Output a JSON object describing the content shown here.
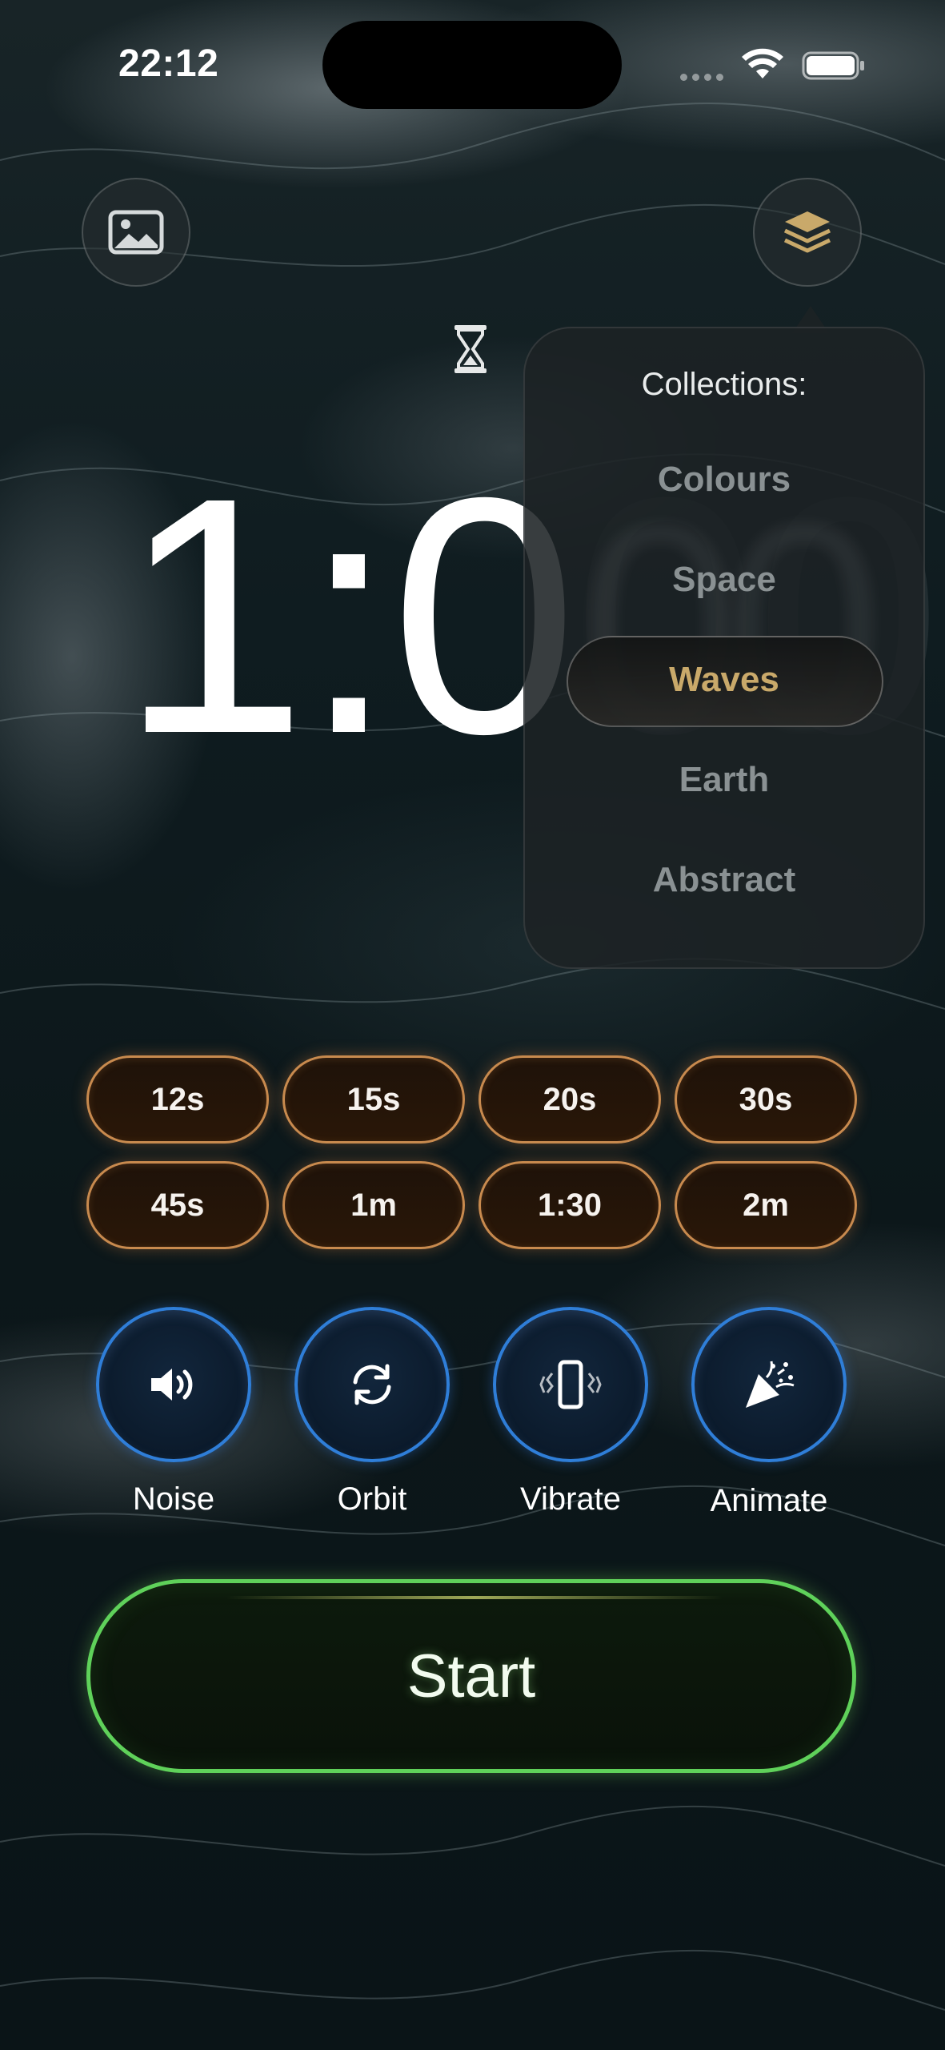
{
  "status_bar": {
    "time": "22:12",
    "wifi_icon": "wifi-icon",
    "battery_icon": "battery-icon"
  },
  "top_bar": {
    "left_icon": "image-gallery-icon",
    "right_icon": "layers-icon",
    "center_icon": "hourglass-icon"
  },
  "timer": {
    "visible": "1:0",
    "hidden": "00"
  },
  "collections": {
    "title": "Collections:",
    "items": [
      {
        "label": "Colours",
        "selected": false
      },
      {
        "label": "Space",
        "selected": false
      },
      {
        "label": "Waves",
        "selected": true
      },
      {
        "label": "Earth",
        "selected": false
      },
      {
        "label": "Abstract",
        "selected": false
      }
    ]
  },
  "durations": [
    "12s",
    "15s",
    "20s",
    "30s",
    "45s",
    "1m",
    "1:30",
    "2m"
  ],
  "toggles": [
    {
      "label": "Noise",
      "icon": "speaker-icon"
    },
    {
      "label": "Orbit",
      "icon": "rotate-icon"
    },
    {
      "label": "Vibrate",
      "icon": "vibrate-phone-icon"
    },
    {
      "label": "Animate",
      "icon": "party-popper-icon"
    }
  ],
  "start": {
    "label": "Start"
  },
  "colors": {
    "duration_border": "#c88a4e",
    "toggle_border": "#2f7ed8",
    "start_border": "#5fd15a",
    "selected_collection": "#c9a96a"
  }
}
